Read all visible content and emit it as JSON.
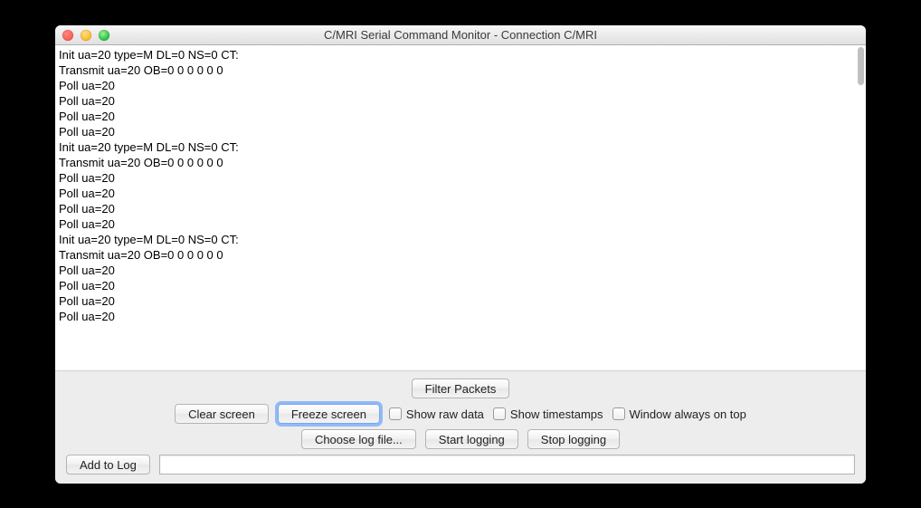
{
  "window": {
    "title": "C/MRI Serial Command Monitor - Connection C/MRI"
  },
  "log_lines": [
    "Init ua=20 type=M DL=0 NS=0 CT:",
    "Transmit ua=20 OB=0 0 0 0 0 0",
    "Poll ua=20",
    "Poll ua=20",
    "Poll ua=20",
    "Poll ua=20",
    "Init ua=20 type=M DL=0 NS=0 CT:",
    "Transmit ua=20 OB=0 0 0 0 0 0",
    "Poll ua=20",
    "Poll ua=20",
    "Poll ua=20",
    "Poll ua=20",
    "Init ua=20 type=M DL=0 NS=0 CT:",
    "Transmit ua=20 OB=0 0 0 0 0 0",
    "Poll ua=20",
    "Poll ua=20",
    "Poll ua=20",
    "Poll ua=20"
  ],
  "buttons": {
    "filter_packets": "Filter Packets",
    "clear_screen": "Clear screen",
    "freeze_screen": "Freeze screen",
    "choose_log_file": "Choose log file...",
    "start_logging": "Start logging",
    "stop_logging": "Stop logging",
    "add_to_log": "Add to Log"
  },
  "checkboxes": {
    "show_raw_data": "Show raw data",
    "show_timestamps": "Show timestamps",
    "window_always_on_top": "Window always on top"
  },
  "inputs": {
    "log_entry": {
      "value": "",
      "placeholder": ""
    }
  }
}
